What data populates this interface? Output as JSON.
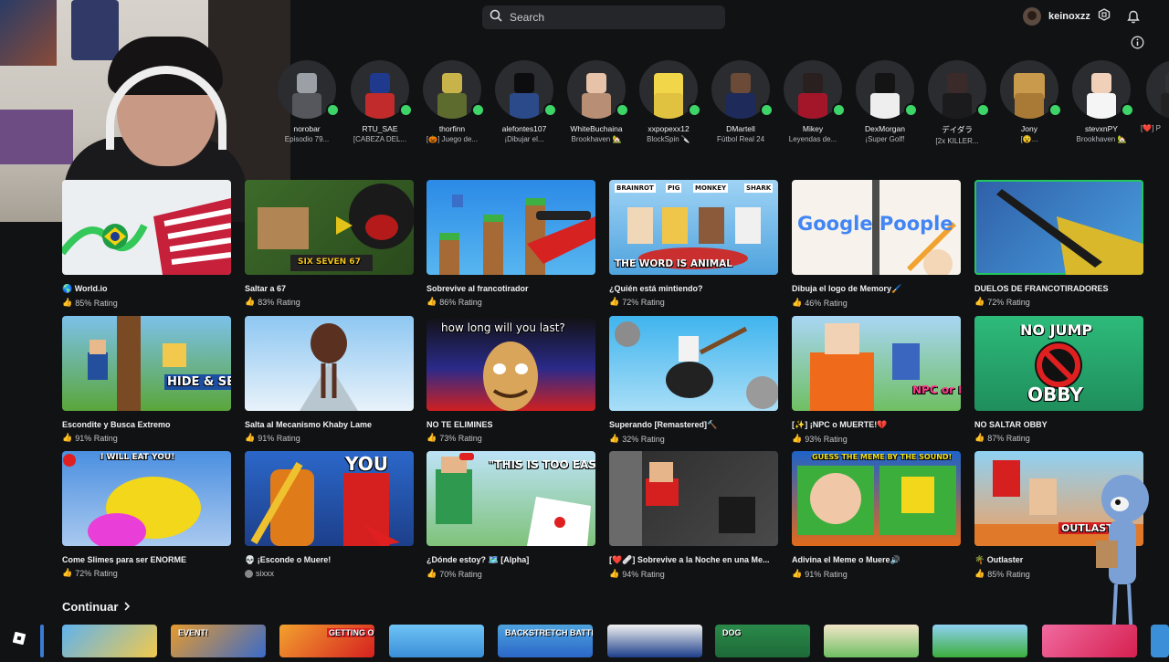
{
  "search": {
    "placeholder": "Search"
  },
  "user": {
    "name": "keinoxzz"
  },
  "friends": [
    {
      "name": "norobar",
      "status": "Episodio 79..."
    },
    {
      "name": "RTU_SAE",
      "status": "[CABEZA DEL..."
    },
    {
      "name": "thorfinn",
      "status": "[🎃] Juego de..."
    },
    {
      "name": "alefontes107",
      "status": "¡Dibujar el..."
    },
    {
      "name": "WhiteBuchaina",
      "status": "Brookhaven 🏡"
    },
    {
      "name": "xxpopexx12",
      "status": "BlockSpin 🔪"
    },
    {
      "name": "DMartell",
      "status": "Fútbol Real 24"
    },
    {
      "name": "Mikey",
      "status": "Leyendas de..."
    },
    {
      "name": "DexMorgan",
      "status": "¡Super Golf!"
    },
    {
      "name": "デイダラ",
      "status": "[2x KILLER..."
    },
    {
      "name": "Jony",
      "status": "[😵..."
    },
    {
      "name": "stevxnPY",
      "status": "Brookhaven 🏡"
    },
    {
      "name": "",
      "status": "[❤️] P"
    }
  ],
  "games": [
    {
      "title": "🌎 World.io",
      "rating": "85% Rating"
    },
    {
      "title": "Saltar a 67",
      "rating": "83% Rating",
      "caption": "SIX SEVEN 67"
    },
    {
      "title": "Sobrevive al francotirador",
      "rating": "86% Rating"
    },
    {
      "title": "¿Quién está mintiendo?",
      "rating": "72% Rating",
      "caption": "THE WORD IS ANIMAL",
      "tags": [
        "BRAINROT",
        "PIG",
        "MONKEY",
        "SHARK"
      ]
    },
    {
      "title": "Dibuja el logo de Memory🖌️",
      "rating": "46% Rating",
      "caption": "Google Poople"
    },
    {
      "title": "DUELOS DE FRANCOTIRADORES",
      "rating": "72% Rating"
    },
    {
      "title": "Escondite y Busca Extremo",
      "rating": "91% Rating",
      "caption": "HIDE & SEEK EXTREME"
    },
    {
      "title": "Salta al Mecanismo Khaby Lame",
      "rating": "91% Rating"
    },
    {
      "title": "NO TE ELIMINES",
      "rating": "73% Rating",
      "caption": "how long will you last?"
    },
    {
      "title": "Superando [Remastered]🔨",
      "rating": "32% Rating"
    },
    {
      "title": "[✨] ¡NPC o MUERTE!💔",
      "rating": "93% Rating",
      "caption": "NPC or DIE"
    },
    {
      "title": "NO SALTAR OBBY",
      "rating": "87% Rating",
      "caption": "NO JUMP",
      "caption2": "OBBY"
    },
    {
      "title": "Come Slimes para ser ENORME",
      "rating": "72% Rating",
      "caption": "I WILL EAT YOU!"
    },
    {
      "title": "💀 ¡Esconde o Muere!",
      "rating": "sixxx",
      "caption": "YOU"
    },
    {
      "title": "¿Dónde estoy? 🗺️ [Alpha]",
      "rating": "70% Rating",
      "caption": "\"THIS IS TOO EASY\""
    },
    {
      "title": "[❤️🩹] Sobrevive a la Noche en una Me...",
      "rating": "94% Rating"
    },
    {
      "title": "Adivina el Meme o Muere🔊",
      "rating": "91% Rating",
      "caption": "GUESS THE MEME BY THE SOUND!"
    },
    {
      "title": "🌴 Outlaster",
      "rating": "85% Rating",
      "caption": "OUTLASTER"
    }
  ],
  "continuar": {
    "label": "Continuar"
  },
  "continue_tiles": [
    {
      "caption": ""
    },
    {
      "caption": ""
    },
    {
      "caption": "EVENT!"
    },
    {
      "caption": "GETTING OVER IT"
    },
    {
      "caption": ""
    },
    {
      "caption": "BACKSTRETCH BATTLES"
    },
    {
      "caption": ""
    },
    {
      "caption": "DOG"
    },
    {
      "caption": ""
    },
    {
      "caption": ""
    }
  ],
  "colors": {
    "background": "#111214",
    "online": "#3dd468",
    "selected_border": "#22c55e"
  }
}
